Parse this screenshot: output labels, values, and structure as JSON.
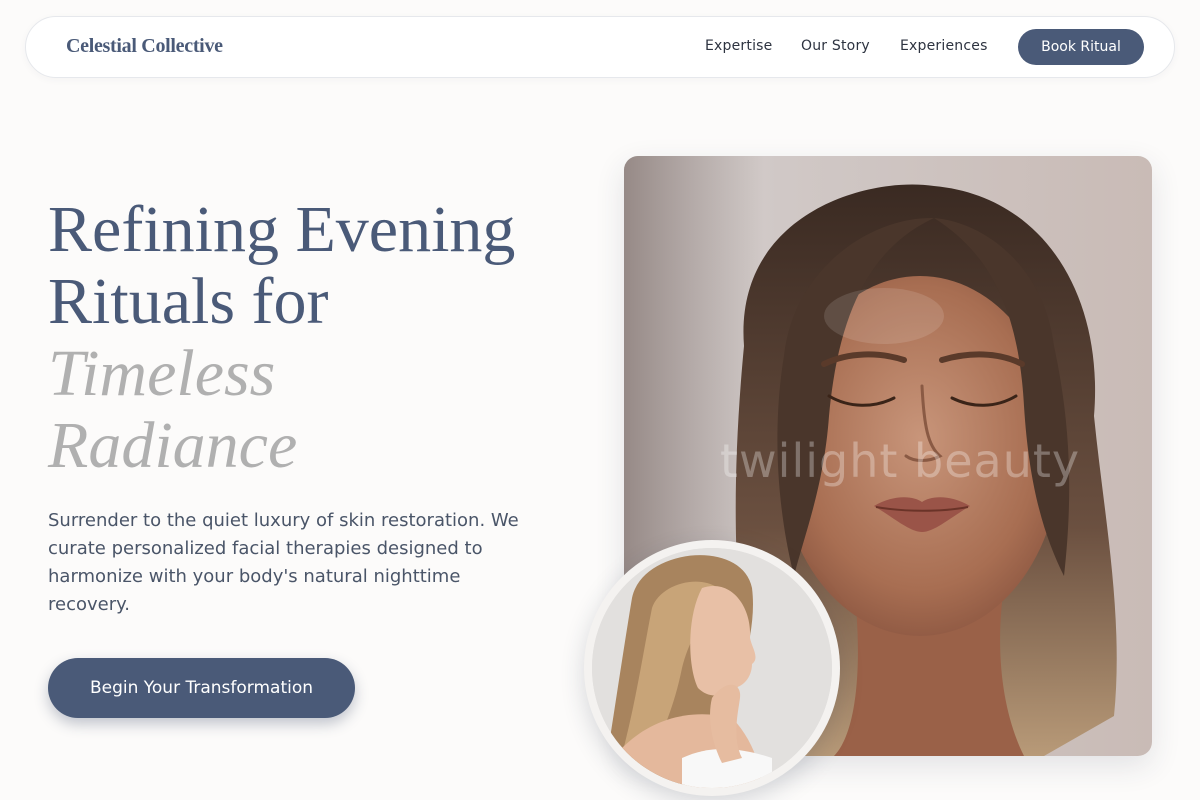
{
  "nav": {
    "logo": "Celestial Collective",
    "links": [
      "Expertise",
      "Our Story",
      "Experiences"
    ],
    "book_label": "Book Ritual"
  },
  "hero": {
    "headline_line1": "Refining Evening",
    "headline_line2": "Rituals for",
    "headline_accent1": "Timeless",
    "headline_accent2": "Radiance",
    "subtext": "Surrender to the quiet luxury of skin restoration. We curate personalized facial therapies designed to harmonize with your body's natural nighttime recovery.",
    "cta_label": "Begin Your Transformation",
    "watermark": "twilight beauty"
  },
  "colors": {
    "accent": "#4a5a78",
    "accent_text": "#b0b0b0",
    "background": "#fcfbfa"
  },
  "images": {
    "main": "closed-eyes-portrait",
    "inset": "profile-portrait"
  }
}
